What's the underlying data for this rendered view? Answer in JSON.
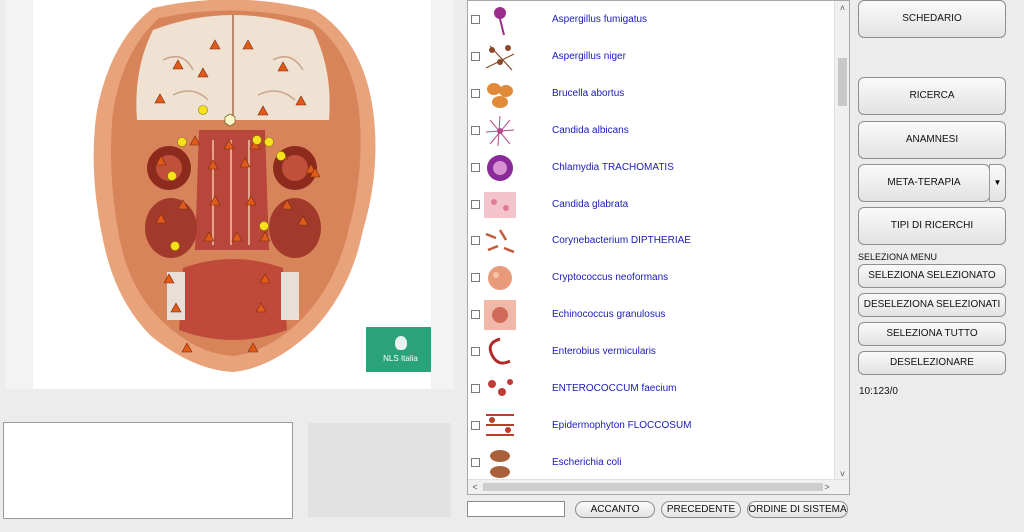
{
  "viewer": {
    "logo_text": "NLS Italia"
  },
  "organisms": [
    {
      "label": "Aspergillus fumigatus",
      "icon": "aspergillus-fumigatus-thumbnail",
      "color": "#9b2d8a"
    },
    {
      "label": "Aspergillus niger",
      "icon": "aspergillus-niger-thumbnail",
      "color": "#8a4a2a"
    },
    {
      "label": "Brucella abortus",
      "icon": "brucella-abortus-thumbnail",
      "color": "#e08a3a"
    },
    {
      "label": "Candida albicans",
      "icon": "candida-albicans-thumbnail",
      "color": "#b04a8a"
    },
    {
      "label": "Chlamydia TRACHOMATIS",
      "icon": "chlamydia-trachomatis-thumbnail",
      "color": "#8a2a9a"
    },
    {
      "label": "Candida glabrata",
      "icon": "candida-glabrata-thumbnail",
      "color": "#e07a9a"
    },
    {
      "label": "Corynebacterium DIPTHERIAE",
      "icon": "corynebacterium-diptheriae-thumbnail",
      "color": "#c05a3a"
    },
    {
      "label": "Cryptococcus neoformans",
      "icon": "cryptococcus-neoformans-thumbnail",
      "color": "#e89a7a"
    },
    {
      "label": "Echinococcus granulosus",
      "icon": "echinococcus-granulosus-thumbnail",
      "color": "#d06a5a"
    },
    {
      "label": "Enterobius vermicularis",
      "icon": "enterobius-vermicularis-thumbnail",
      "color": "#b02a2a"
    },
    {
      "label": "ENTEROCOCCUM faecium",
      "icon": "enterococcum-faecium-thumbnail",
      "color": "#c03a3a"
    },
    {
      "label": "Epidermophyton FLOCCOSUM",
      "icon": "epidermophyton-floccosum-thumbnail",
      "color": "#b8402a"
    },
    {
      "label": "Escherichia coli",
      "icon": "escherichia-coli-thumbnail",
      "color": "#a8603a"
    }
  ],
  "nav": {
    "page_value": "",
    "next_label": "ACCANTO",
    "prev_label": "PRECEDENTE",
    "order_label": "ORDINE DI SISTEMA"
  },
  "menu": {
    "schedario": "SCHEDARIO",
    "ricerca": "RICERCA",
    "anamnesi": "ANAMNESI",
    "meta_terapia": "META-TERAPIA",
    "meta_arrow": "▼",
    "tipi_ricerchi": "TIPI DI RICERCHI",
    "section_label": "SELEZIONA MENU",
    "seleziona_selezionato": "SELEZIONA SELEZIONATO",
    "deseleziona_selezionati": "DESELEZIONA SELEZIONATI",
    "seleziona_tutto": "SELEZIONA TUTTO",
    "deselezionare": "DESELEZIONARE",
    "status": "10:123/0"
  },
  "scroll": {
    "up": "˄",
    "down": "˅",
    "left": "<",
    "right": ">"
  }
}
